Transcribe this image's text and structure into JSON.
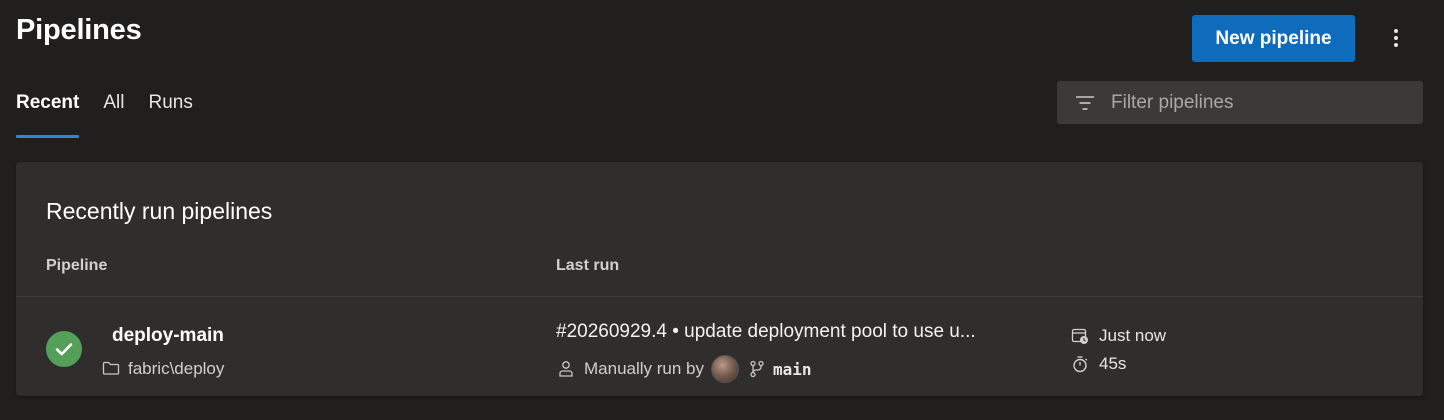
{
  "page": {
    "title": "Pipelines",
    "new_button_label": "New pipeline",
    "more_icon": "more-vertical-icon"
  },
  "tabs": [
    {
      "label": "Recent",
      "active": true
    },
    {
      "label": "All",
      "active": false
    },
    {
      "label": "Runs",
      "active": false
    }
  ],
  "filter": {
    "placeholder": "Filter pipelines",
    "value": "",
    "icon": "filter-icon"
  },
  "card": {
    "title": "Recently run pipelines",
    "columns": {
      "pipeline": "Pipeline",
      "last_run": "Last run"
    }
  },
  "rows": [
    {
      "status": "succeeded",
      "status_color": "#54a05a",
      "name": "deploy-main",
      "folder": "fabric\\deploy",
      "run_title": "#20260929.4 • update deployment pool to use u...",
      "trigger": "Manually run by",
      "branch": "main",
      "when": "Just now",
      "duration": "45s"
    }
  ],
  "colors": {
    "accent": "#0f6cbd",
    "tab_underline": "#2b88d8",
    "background": "#201f1e",
    "card": "#2f2e2d"
  }
}
